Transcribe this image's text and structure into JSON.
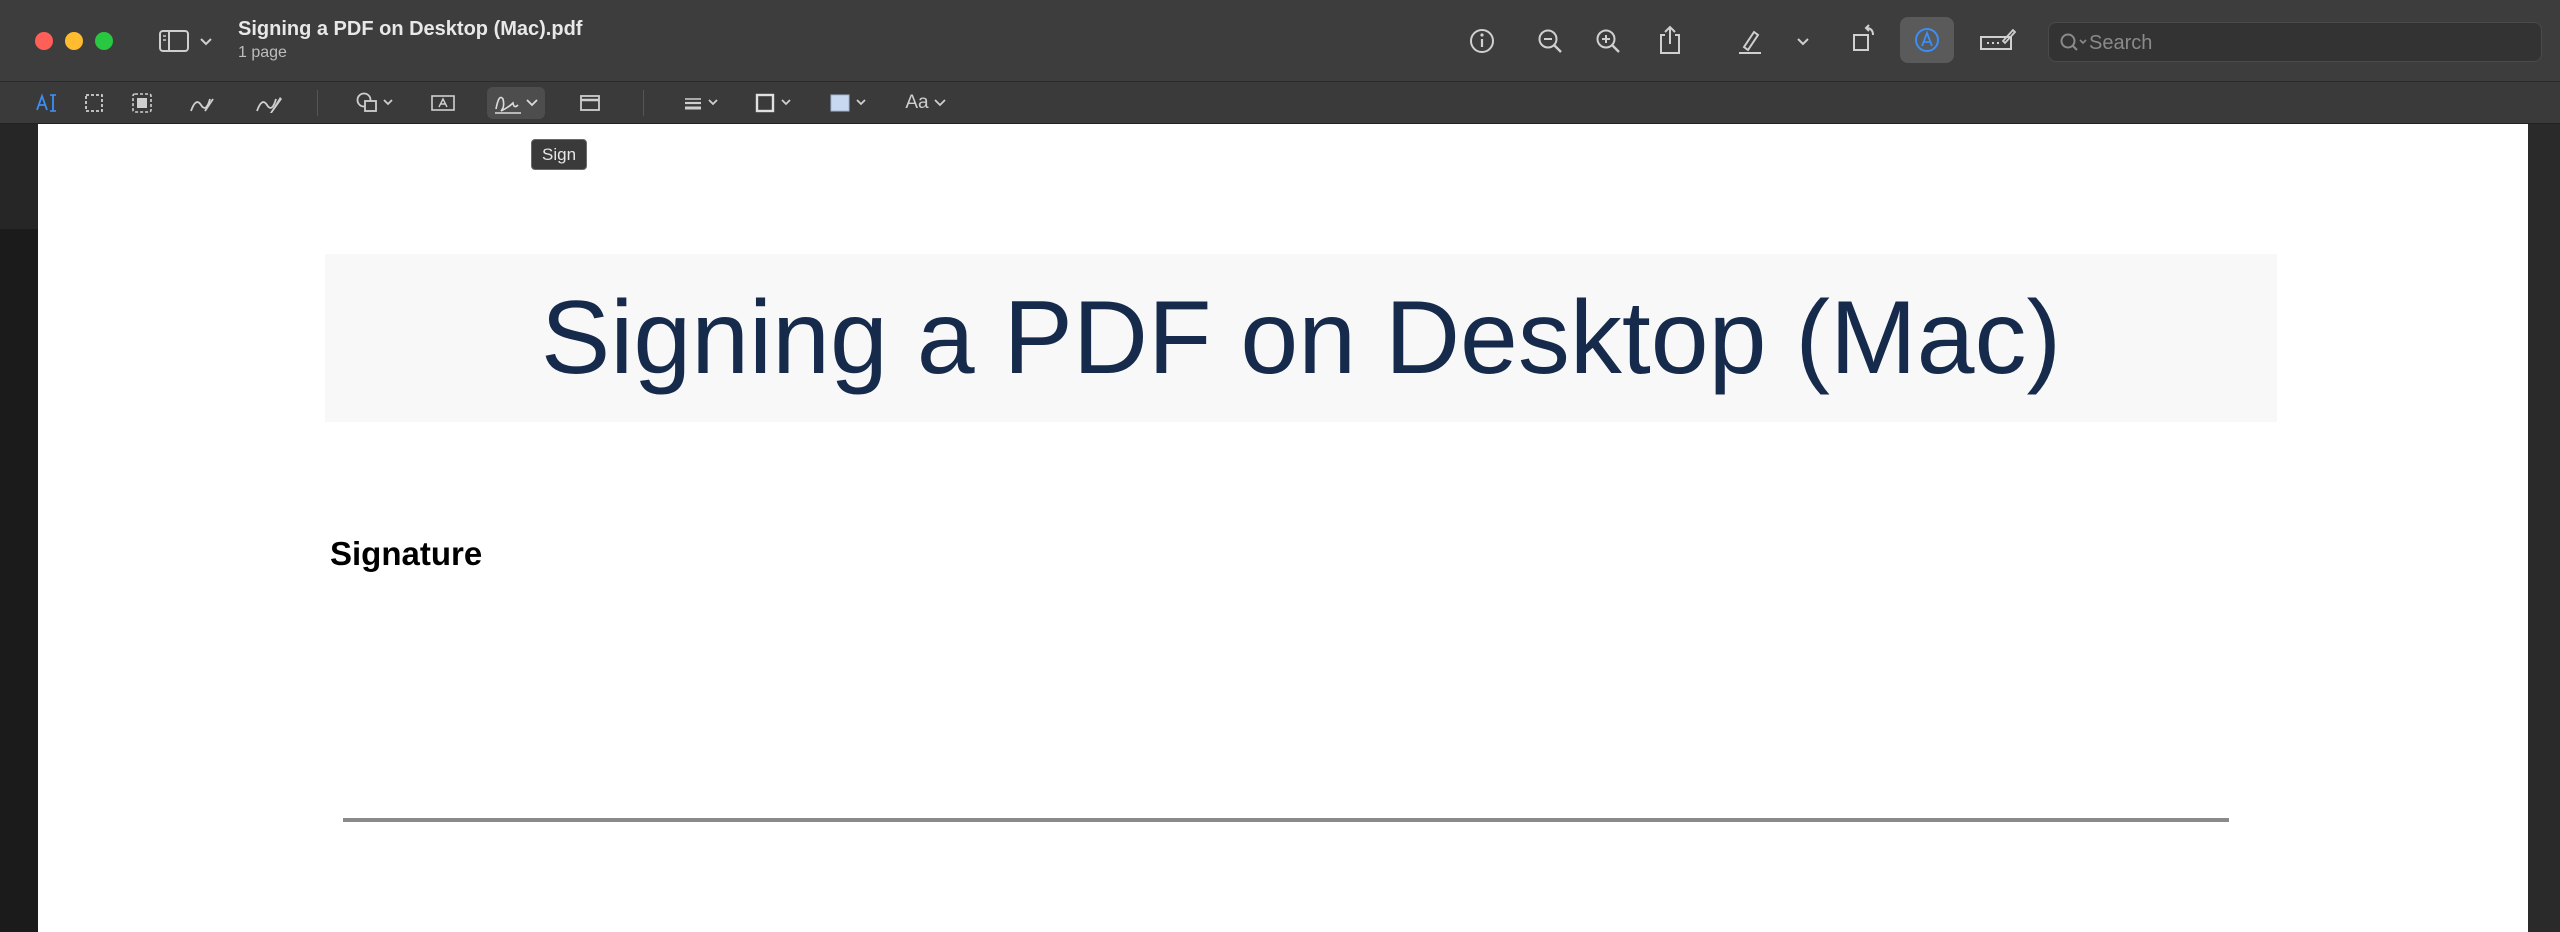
{
  "window": {
    "title": "Signing a PDF on Desktop (Mac).pdf",
    "subtitle": "1 page"
  },
  "toolbar": {
    "icons": [
      "sidebar-icon",
      "chevron-down-icon",
      "info-icon",
      "zoom-out-icon",
      "zoom-in-icon",
      "share-icon",
      "highlight-pen-icon",
      "chevron-down-icon",
      "rotate-icon",
      "markup-icon",
      "form-filling-icon"
    ],
    "search_placeholder": "Search"
  },
  "markup_toolbar": {
    "icons": [
      "text-selection-icon",
      "rectangular-selection-icon",
      "smart-lasso-icon",
      "sketch-icon",
      "draw-icon",
      "shapes-icon",
      "text-box-icon",
      "signature-icon",
      "note-icon",
      "line-style-icon",
      "border-color-icon",
      "fill-color-icon",
      "text-style-icon"
    ],
    "text_style_label": "Aa",
    "tooltip": "Sign"
  },
  "document": {
    "title": "Signing a PDF on Desktop (Mac)",
    "signature_label": "Signature"
  },
  "colors": {
    "title_text": "#162a4b",
    "markup_accent": "#3b8ff5",
    "close": "#ff5f57",
    "minimize": "#febc2e",
    "maximize": "#28c840"
  }
}
